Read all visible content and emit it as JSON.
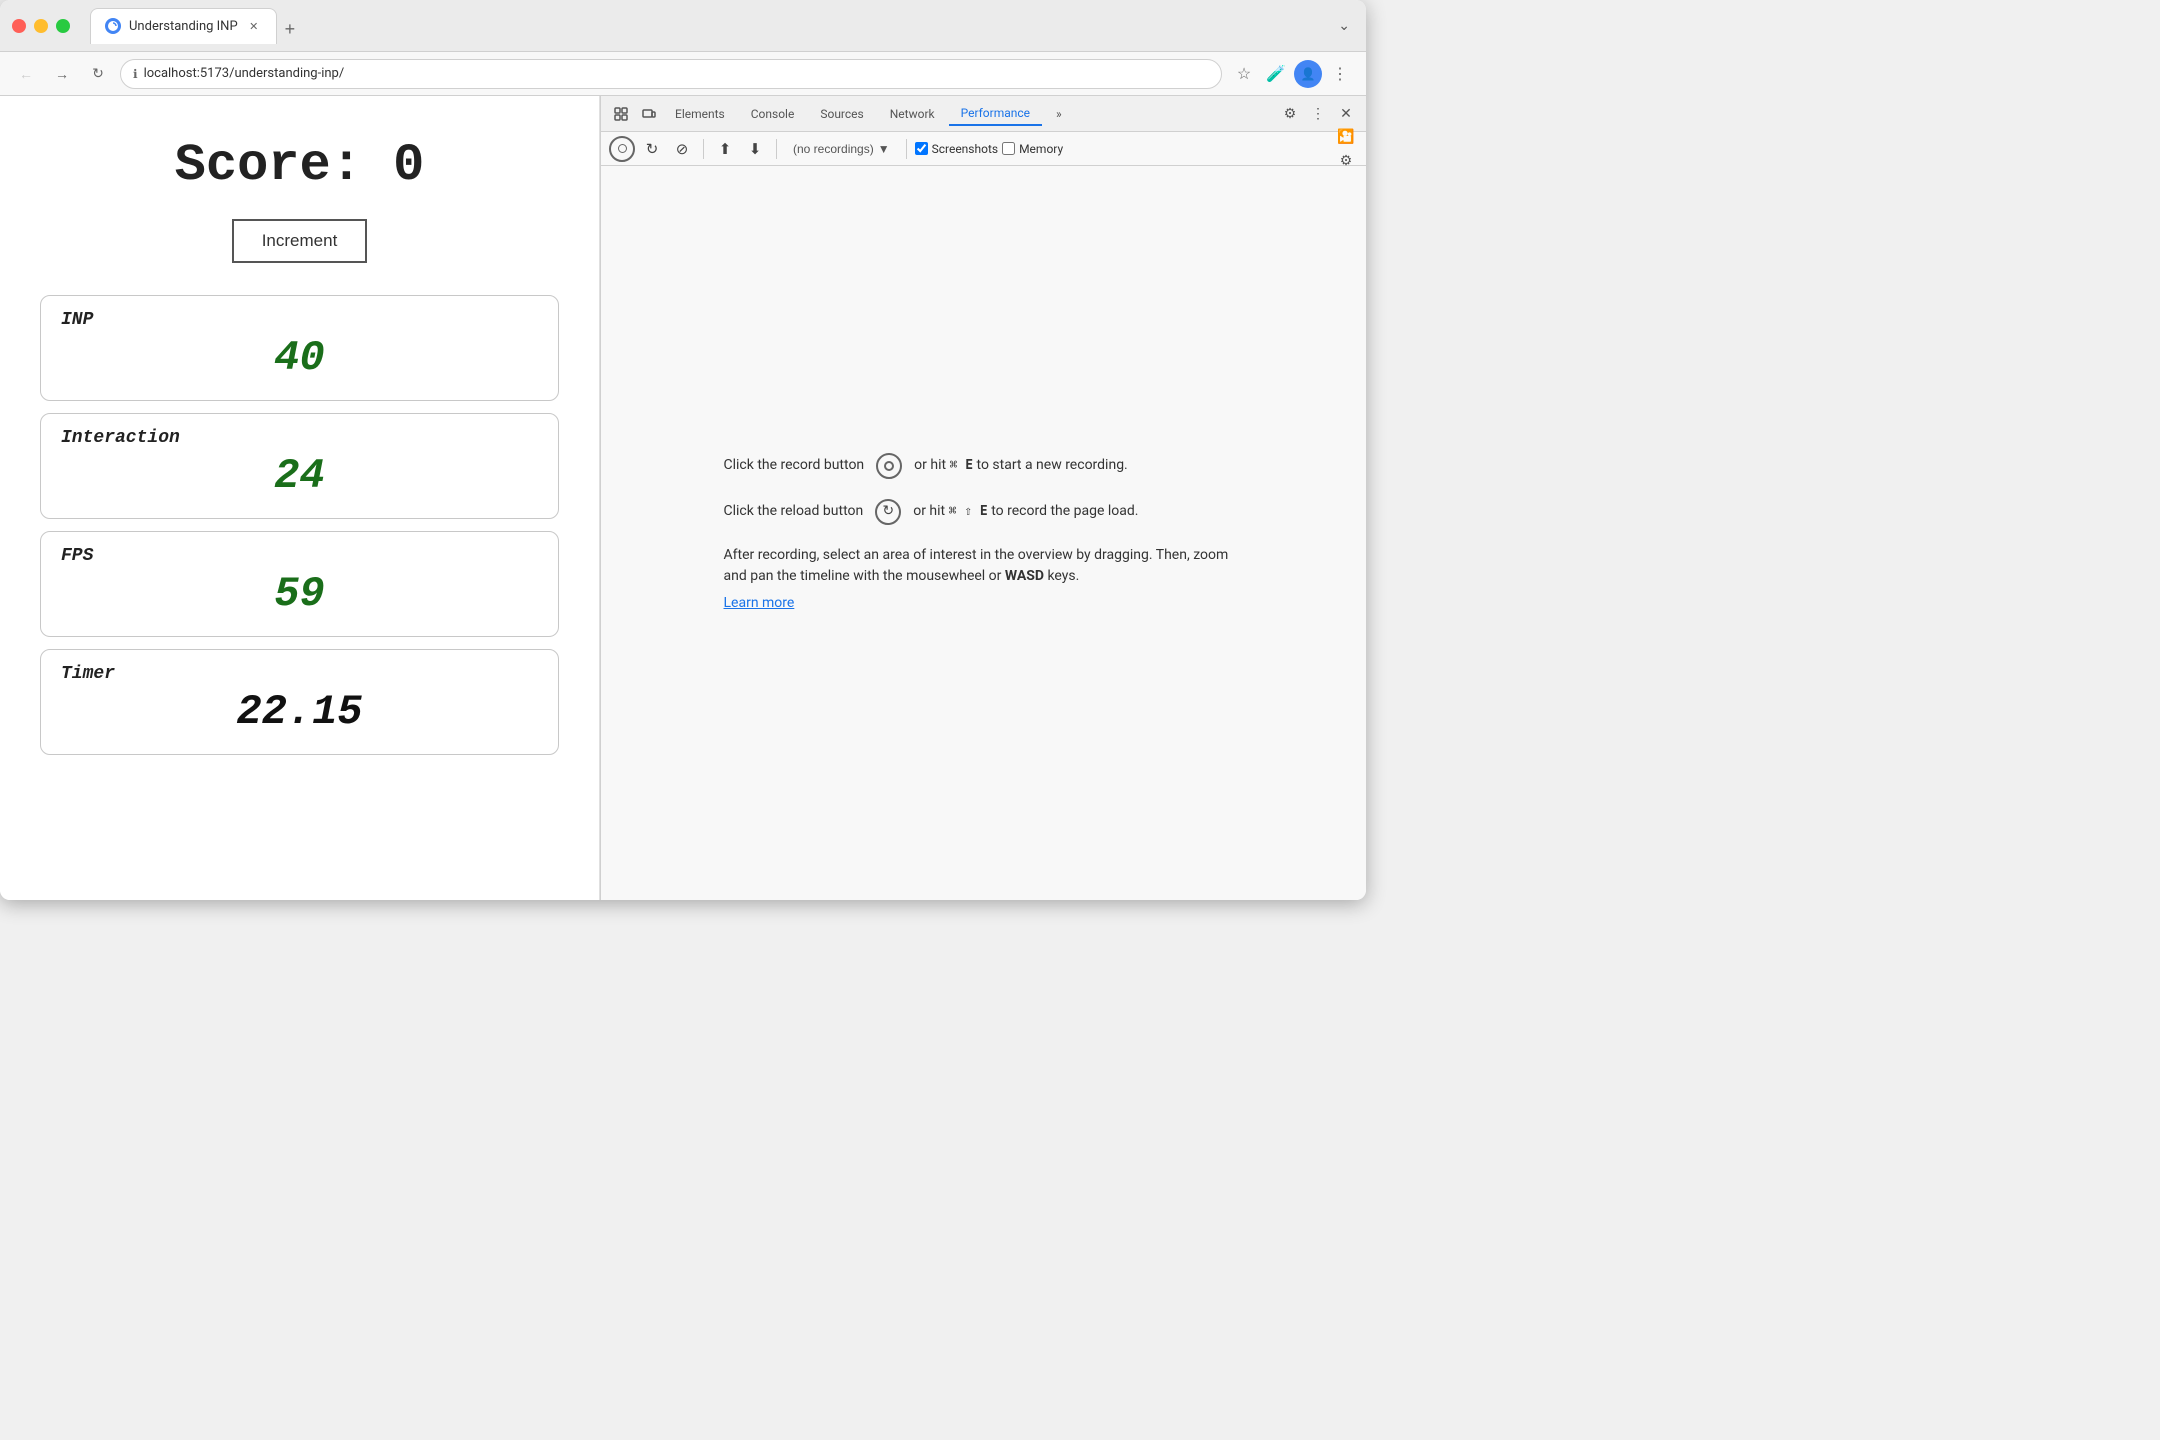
{
  "browser": {
    "tab_title": "Understanding INP",
    "url": "localhost:5173/understanding-inp/",
    "new_tab_label": "+",
    "tab_overflow_label": "⌄"
  },
  "toolbar": {
    "back_label": "←",
    "forward_label": "→",
    "reload_label": "↻",
    "bookmark_label": "☆",
    "extension_label": "🧪",
    "avatar_label": "👤",
    "more_label": "⋮"
  },
  "webpage": {
    "score_label": "Score: 0",
    "increment_button": "Increment",
    "metrics": [
      {
        "id": "inp",
        "label": "INP",
        "value": "40",
        "is_timer": false
      },
      {
        "id": "interaction",
        "label": "Interaction",
        "value": "24",
        "is_timer": false
      },
      {
        "id": "fps",
        "label": "FPS",
        "value": "59",
        "is_timer": false
      },
      {
        "id": "timer",
        "label": "Timer",
        "value": "22.15",
        "is_timer": true
      }
    ]
  },
  "devtools": {
    "tabs": [
      {
        "id": "elements",
        "label": "Elements",
        "active": false
      },
      {
        "id": "console",
        "label": "Console",
        "active": false
      },
      {
        "id": "sources",
        "label": "Sources",
        "active": false
      },
      {
        "id": "network",
        "label": "Network",
        "active": false
      },
      {
        "id": "performance",
        "label": "Performance",
        "active": true
      },
      {
        "id": "more",
        "label": "»",
        "active": false
      }
    ],
    "toolbar": {
      "record_title": "Record",
      "reload_title": "Reload",
      "clear_title": "Clear",
      "upload_title": "Upload",
      "download_title": "Download",
      "recordings_placeholder": "(no recordings)",
      "screenshots_label": "Screenshots",
      "memory_label": "Memory"
    },
    "instructions": {
      "record_text": "Click the record button",
      "record_shortcut": "⌘ E",
      "record_suffix": "to start a new recording.",
      "reload_text": "Click the reload button",
      "reload_shortcut": "⌘ ⇧ E",
      "reload_suffix": "to record the page load.",
      "description": "After recording, select an area of interest in the overview by dragging. Then, zoom and pan the timeline with the mousewheel or",
      "wasd_keys": "WASD",
      "keys_suffix": "keys.",
      "learn_more": "Learn more"
    }
  }
}
